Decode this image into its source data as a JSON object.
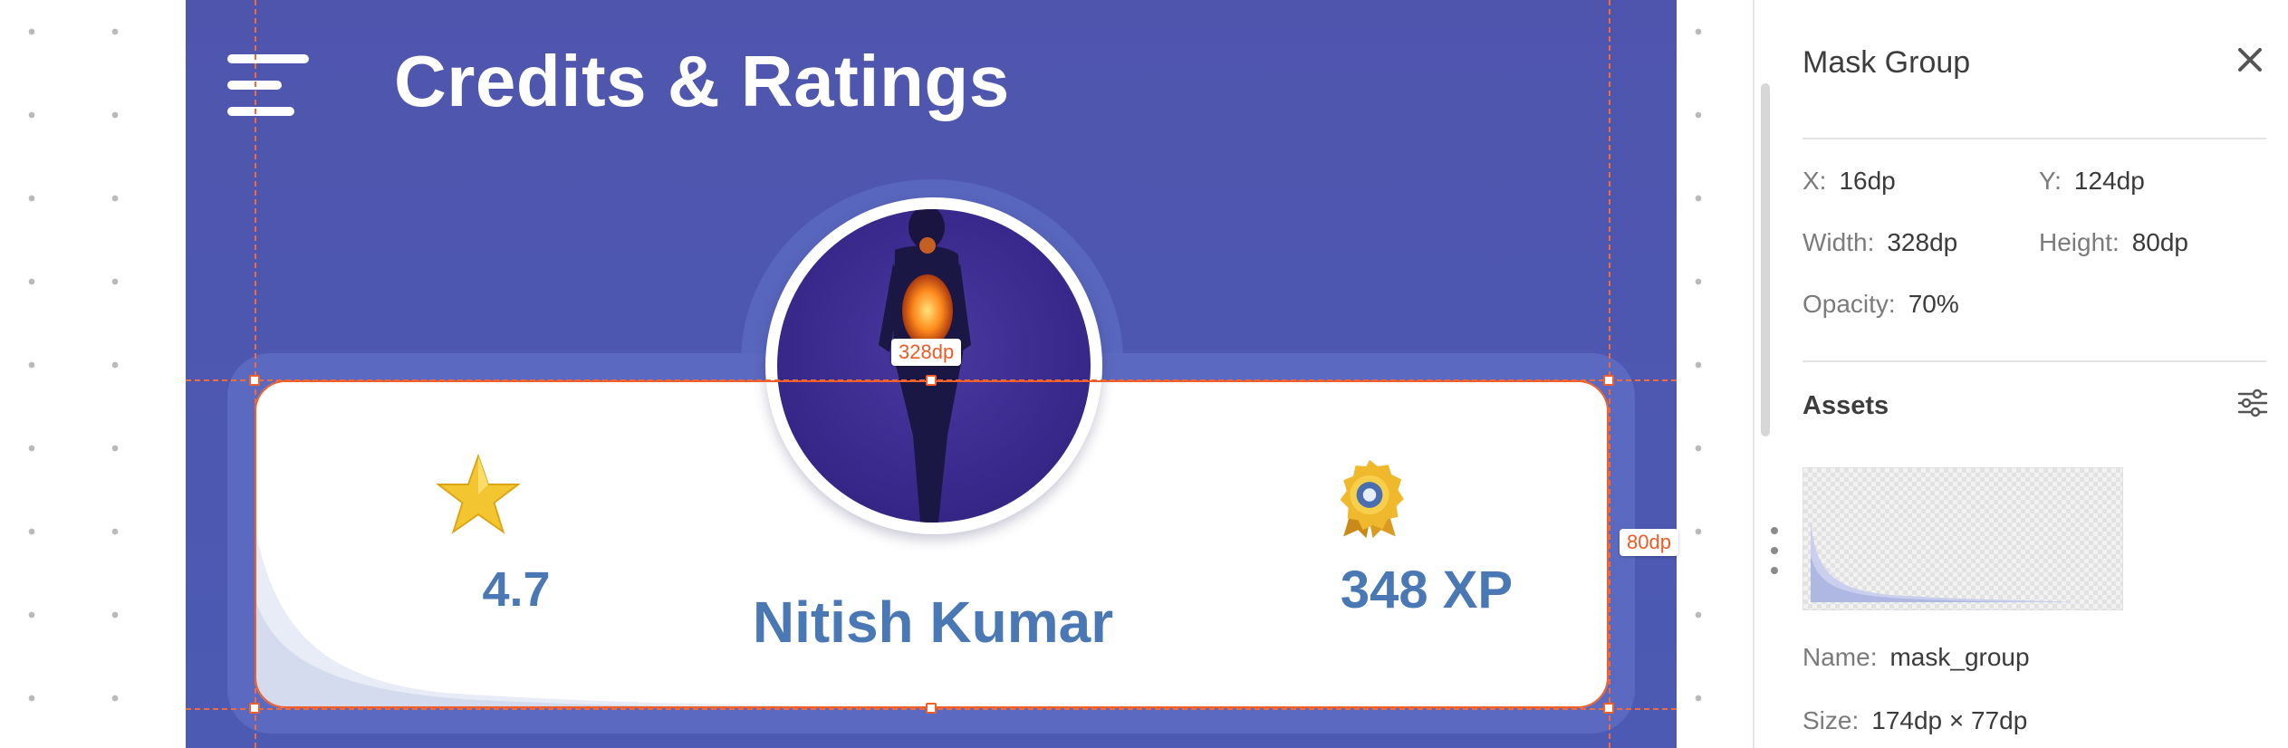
{
  "app": {
    "title": "Credits & Ratings"
  },
  "profile": {
    "rating": "4.7",
    "name": "Nitish Kumar",
    "xp": "348 XP"
  },
  "selection": {
    "width_label": "328dp",
    "height_label": "80dp"
  },
  "inspector": {
    "title": "Mask Group",
    "props": {
      "x_label": "X:",
      "x_value": "16dp",
      "y_label": "Y:",
      "y_value": "124dp",
      "width_label": "Width:",
      "width_value": "328dp",
      "height_label": "Height:",
      "height_value": "80dp",
      "opacity_label": "Opacity:",
      "opacity_value": "70%"
    },
    "assets": {
      "title": "Assets",
      "name_label": "Name:",
      "name_value": "mask_group",
      "size_label": "Size:",
      "size_value": "174dp × 77dp"
    }
  },
  "icons": {
    "menu": "hamburger-menu-icon",
    "rating": "star-icon",
    "xp": "medal-icon",
    "close": "close-icon",
    "filter": "filter-sliders-icon",
    "drag": "drag-handle-icon"
  },
  "colors": {
    "device_bg": "#4f55ad",
    "accent_text": "#4a78b4",
    "selection": "#f0602a",
    "star": "#f2c531",
    "medal": "#f0b92d"
  }
}
